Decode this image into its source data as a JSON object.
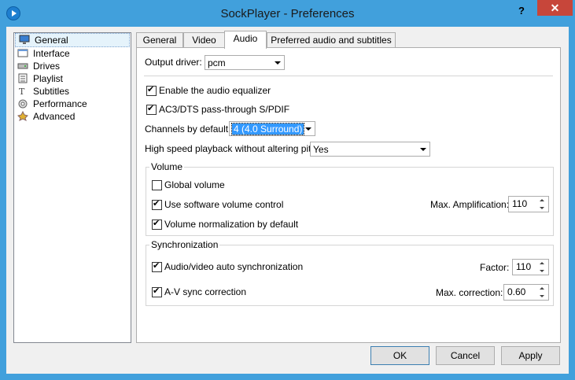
{
  "window": {
    "title": "SockPlayer - Preferences",
    "help_label": "?",
    "close_label": "✕"
  },
  "sidebar": {
    "items": [
      {
        "label": "General",
        "icon": "monitor-icon"
      },
      {
        "label": "Interface",
        "icon": "interface-icon"
      },
      {
        "label": "Drives",
        "icon": "drive-icon"
      },
      {
        "label": "Playlist",
        "icon": "playlist-icon"
      },
      {
        "label": "Subtitles",
        "icon": "subtitles-icon"
      },
      {
        "label": "Performance",
        "icon": "performance-icon"
      },
      {
        "label": "Advanced",
        "icon": "advanced-icon"
      }
    ],
    "selected": "General"
  },
  "tabs": [
    {
      "label": "General"
    },
    {
      "label": "Video"
    },
    {
      "label": "Audio"
    },
    {
      "label": "Preferred audio and subtitles"
    }
  ],
  "active_tab": "Audio",
  "audio": {
    "output_driver_label": "Output driver:",
    "output_driver_value": "pcm",
    "equalizer_label": "Enable the audio equalizer",
    "equalizer_checked": true,
    "passthrough_label": "AC3/DTS pass-through S/PDIF",
    "passthrough_checked": true,
    "channels_label": "Channels by default:",
    "channels_value": "4 (4.0 Surround)",
    "highspeed_label": "High speed playback without altering pitch",
    "highspeed_value": "Yes"
  },
  "volume": {
    "title": "Volume",
    "global_label": "Global volume",
    "global_checked": false,
    "software_label": "Use software volume control",
    "software_checked": true,
    "max_amp_label": "Max. Amplification:",
    "max_amp_value": "110",
    "normalization_label": "Volume normalization by default",
    "normalization_checked": true
  },
  "sync": {
    "title": "Synchronization",
    "auto_label": "Audio/video auto synchronization",
    "auto_checked": true,
    "factor_label": "Factor:",
    "factor_value": "110",
    "av_label": "A-V sync correction",
    "av_checked": true,
    "max_corr_label": "Max. correction:",
    "max_corr_value": "0.60"
  },
  "buttons": {
    "ok": "OK",
    "cancel": "Cancel",
    "apply": "Apply"
  }
}
